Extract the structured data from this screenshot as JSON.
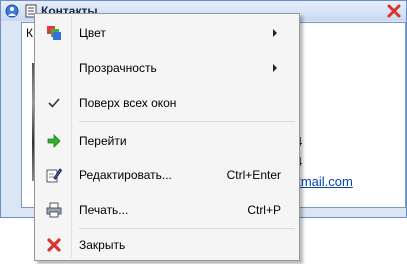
{
  "window": {
    "title": "Контакты",
    "content_letter": "К",
    "fragment_line1": "4",
    "fragment_line2": "4",
    "email_fragment": "otmail.com"
  },
  "menu": {
    "items": [
      {
        "label": "Цвет",
        "icon": "color-palette-icon",
        "submenu": true
      },
      {
        "label": "Прозрачность",
        "icon": "",
        "submenu": true
      },
      {
        "label": "Поверх всех окон",
        "icon": "checkmark-icon",
        "checked": true
      },
      {
        "label": "Перейти",
        "icon": "green-arrow-right-icon"
      },
      {
        "label": "Редактировать...",
        "shortcut": "Ctrl+Enter",
        "icon": "edit-pencil-icon"
      },
      {
        "label": "Печать...",
        "shortcut": "Ctrl+P",
        "icon": "printer-icon"
      },
      {
        "label": "Закрыть",
        "icon": "red-close-x-icon"
      }
    ]
  },
  "colors": {
    "window_border": "#6d8fc7",
    "titlebar_top": "#e6eefb",
    "titlebar_bottom": "#c9d9f2",
    "menu_bg": "#f5f5f5",
    "link": "#0645ad",
    "close_red": "#d9342b",
    "arrow_green": "#2fb12f"
  }
}
